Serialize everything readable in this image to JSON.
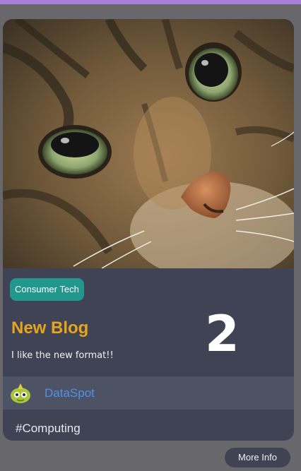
{
  "card": {
    "tag": "Consumer Tech",
    "number": "2",
    "title": "New Blog",
    "body": "I like the new format!!",
    "author": {
      "name": "DataSpot",
      "avatar_icon": "robot-avatar-icon"
    },
    "hashtag": "#Computing",
    "image_icon": "cat-photo"
  },
  "actions": {
    "more_info": "More Info"
  },
  "colors": {
    "page_bg": "#68676c",
    "top_accent": "#a77fd6",
    "card_bg": "#3f4354",
    "tag_bg": "#22978e",
    "title": "#e6a51f",
    "author": "#4f93e8"
  }
}
